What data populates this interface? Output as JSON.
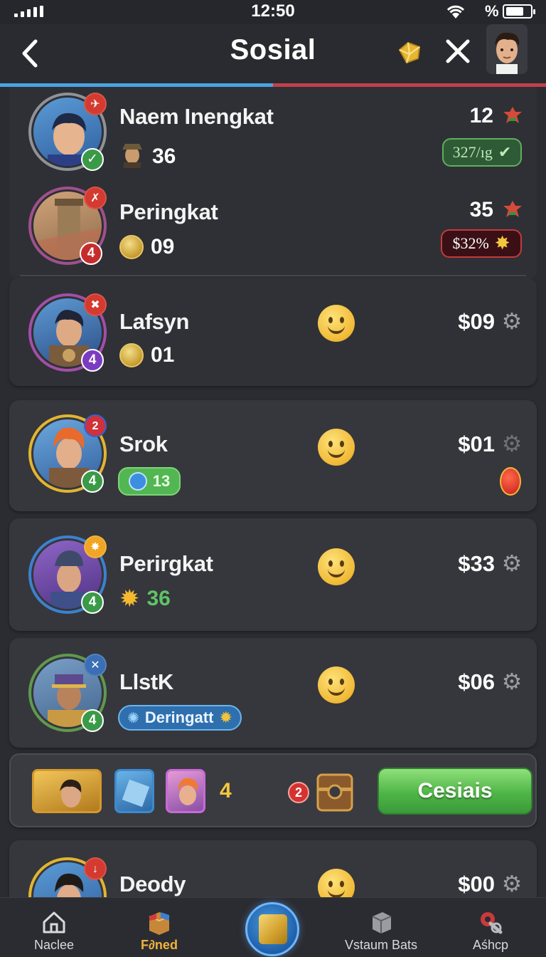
{
  "status_bar": {
    "time": "12:50",
    "battery_label": "%"
  },
  "header": {
    "title": "Sosial",
    "back_icon": "chevron-left-icon",
    "close_icon": "close-icon",
    "progress": 0.5
  },
  "rows": [
    {
      "name": "Naem Inengkat",
      "sub_value": "36",
      "rank": "12",
      "pill": "327/ıg"
    },
    {
      "name": "Peringkat",
      "sub_value": "09",
      "rank": "35",
      "pill": "$32%",
      "level": "4"
    },
    {
      "name": "Lafsyn",
      "sub_value": "01",
      "amount": "$09",
      "level": "4"
    },
    {
      "name": "Srok",
      "sub_value": "13",
      "amount": "$01",
      "level": "4",
      "badge": "2"
    },
    {
      "name": "Perirgkat",
      "sub_value": "36",
      "amount": "$33",
      "level": "4"
    },
    {
      "name": "LlstK",
      "sub_value": "Deringatt",
      "amount": "$06",
      "level": "4"
    },
    {
      "name": "Deody",
      "amount": "$00"
    }
  ],
  "reward_card": {
    "count": "4",
    "badge": "2",
    "button_label": "Cesiais"
  },
  "bottom_nav": [
    {
      "label": "Naclee",
      "icon": "home-icon"
    },
    {
      "label": "F∂ned",
      "icon": "box-icon"
    },
    {
      "label": "",
      "icon": "treasure-icon"
    },
    {
      "label": "Vstaum Bats",
      "icon": "cube-icon"
    },
    {
      "label": "Aśhcp",
      "icon": "shop-icon"
    }
  ]
}
